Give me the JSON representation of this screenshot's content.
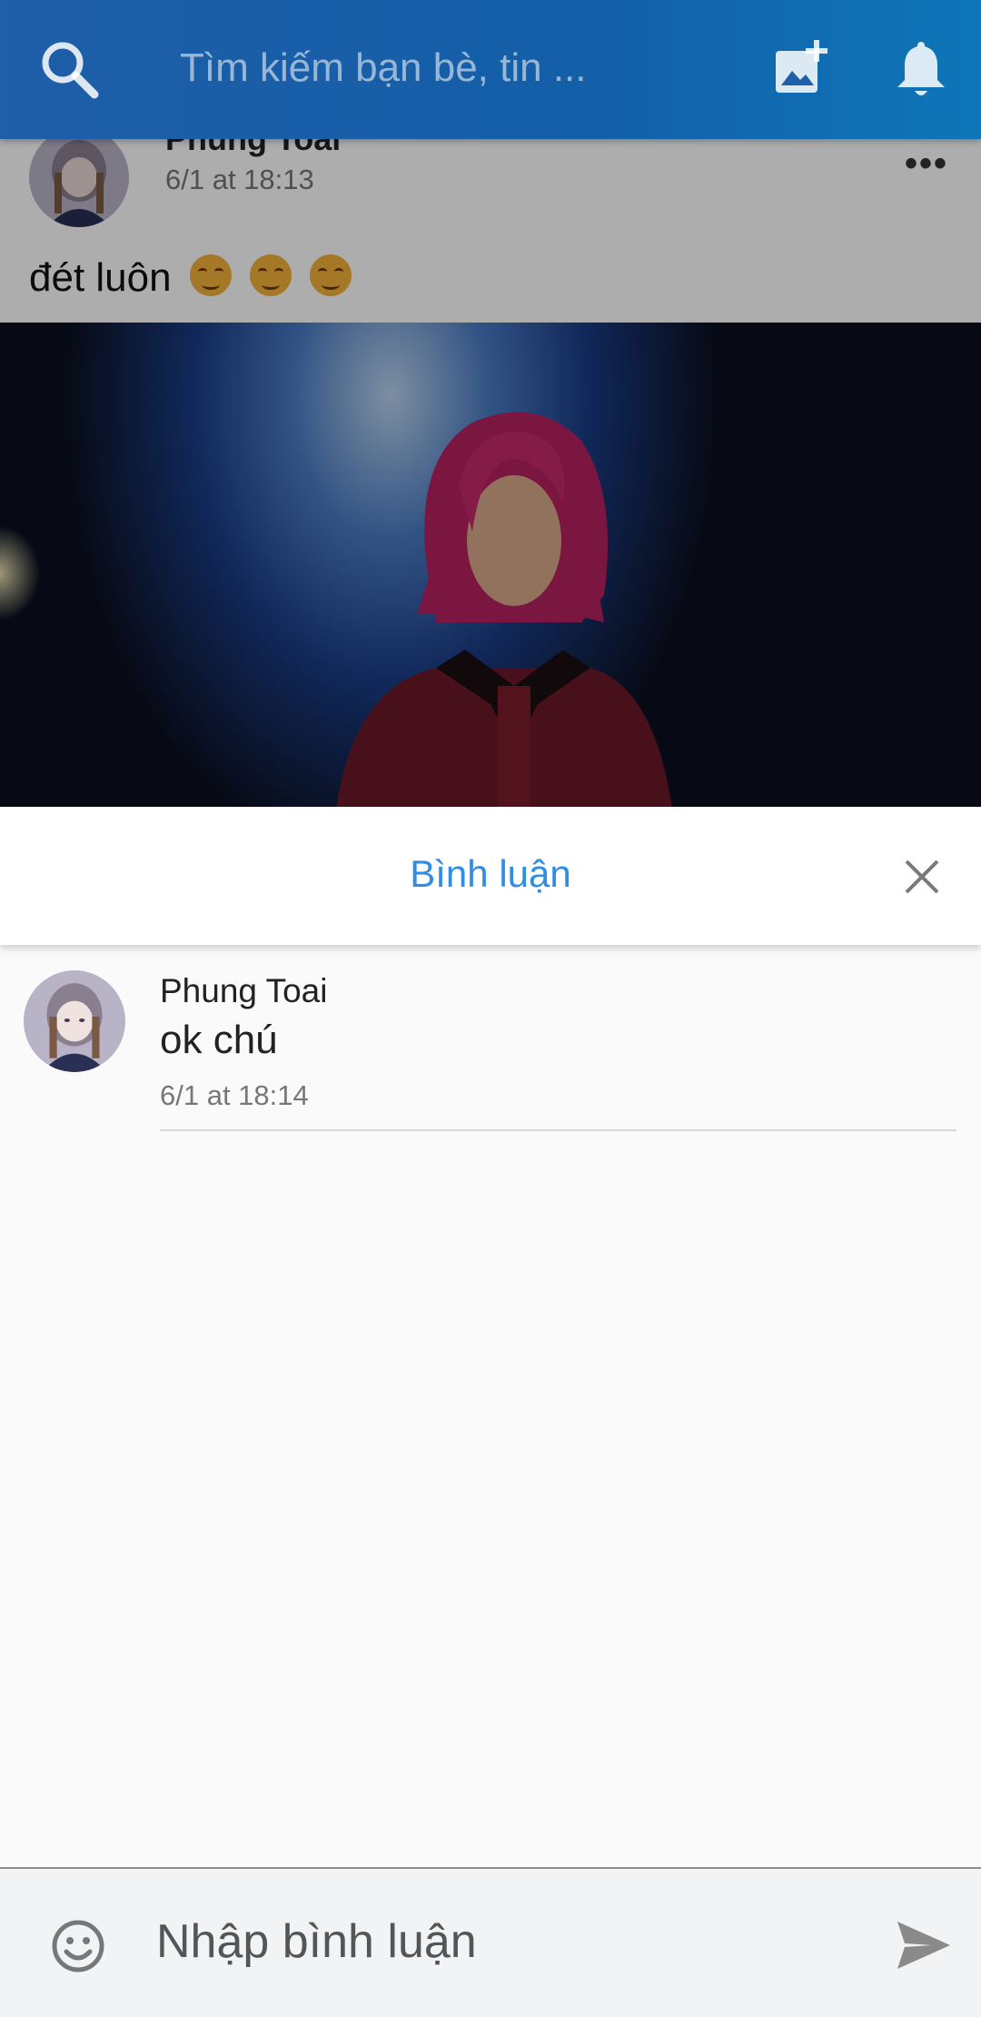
{
  "app_bar": {
    "search_placeholder": "Tìm kiếm bạn bè, tin ...",
    "icons": [
      "search-icon",
      "add-photo-icon",
      "bell-icon"
    ]
  },
  "post": {
    "author": "Phung Toai",
    "time": "6/1 at 18:13",
    "text": "đét luôn",
    "emoji_count": 3
  },
  "comments_sheet": {
    "title": "Bình luận",
    "comments": [
      {
        "author": "Phung Toai",
        "text": "ok chú",
        "time": "6/1 at 18:14"
      }
    ]
  },
  "composer": {
    "placeholder": "Nhập bình luận"
  },
  "colors": {
    "appbar": "#135fa8",
    "accent": "#2f8de4"
  }
}
